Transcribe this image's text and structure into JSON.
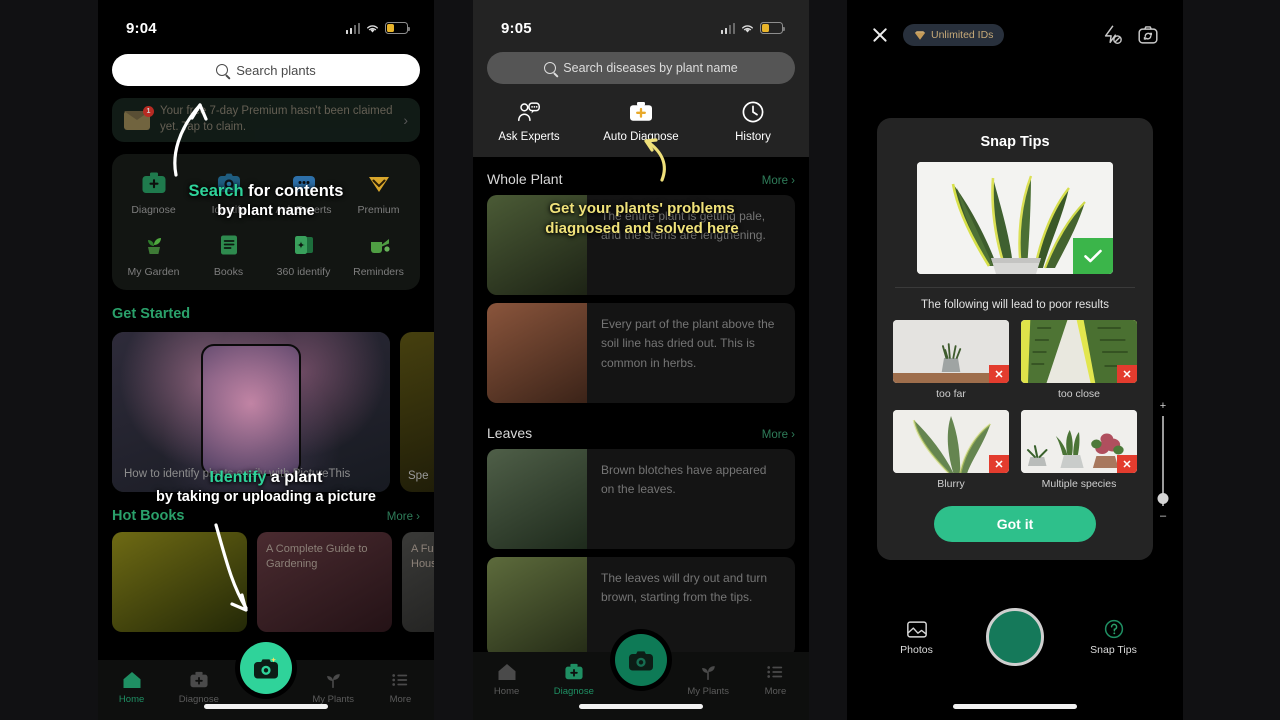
{
  "phone1": {
    "status": {
      "time": "9:04",
      "signal_icon": "cellular-signal-icon",
      "wifi_icon": "wifi-icon",
      "battery_icon": "battery-low-icon"
    },
    "search": {
      "placeholder": "Search plants",
      "icon": "search-icon"
    },
    "promo": {
      "text": "Your free 7-day Premium hasn't been claimed yet. Tap to claim.",
      "badge": "1",
      "icon": "envelope-icon",
      "chevron": "chevron-right-icon"
    },
    "shortcuts": [
      {
        "label": "Diagnose",
        "icon": "first-aid-kit-icon"
      },
      {
        "label": "Identify",
        "icon": "camera-identify-icon"
      },
      {
        "label": "Ask Experts",
        "icon": "chat-bubble-icon"
      },
      {
        "label": "Premium",
        "icon": "diamond-icon"
      },
      {
        "label": "My Garden",
        "icon": "potted-sprout-icon"
      },
      {
        "label": "Books",
        "icon": "book-icon"
      },
      {
        "label": "360 identify",
        "icon": "cards-icon"
      },
      {
        "label": "Reminders",
        "icon": "watering-can-icon"
      }
    ],
    "get_started": {
      "title": "Get Started",
      "card1_caption": "How to identify plants easily with PictureThis",
      "card2_caption": "Spe"
    },
    "hot_books": {
      "title": "Hot Books",
      "more": "More",
      "books": [
        "",
        "A Complete Guide to Gardening",
        "A Full Guide to Popular Houseplants"
      ]
    },
    "tabbar": [
      {
        "label": "Home",
        "icon": "home-icon",
        "active": true
      },
      {
        "label": "Diagnose",
        "icon": "first-aid-kit-icon",
        "active": false
      },
      {
        "label": "My Plants",
        "icon": "leaf-icon",
        "active": false
      },
      {
        "label": "More",
        "icon": "list-icon",
        "active": false
      }
    ],
    "fab": {
      "icon": "camera-icon"
    }
  },
  "phone2": {
    "status": {
      "time": "9:05"
    },
    "search": {
      "placeholder": "Search diseases by plant name",
      "icon": "search-icon"
    },
    "tabs": [
      {
        "label": "Ask Experts",
        "icon": "experts-chat-icon"
      },
      {
        "label": "Auto Diagnose",
        "icon": "first-aid-kit-icon"
      },
      {
        "label": "History",
        "icon": "clock-icon"
      }
    ],
    "sections": [
      {
        "title": "Whole Plant",
        "more": "More",
        "items": [
          {
            "text": "The entire plant is getting pale, and the stems are lengthening."
          },
          {
            "text": "Every part of the plant above the soil line has dried out. This is common in herbs."
          }
        ]
      },
      {
        "title": "Leaves",
        "more": "More",
        "items": [
          {
            "text": "Brown blotches have appeared on the leaves."
          },
          {
            "text": "The leaves will dry out and turn brown, starting from the tips."
          }
        ]
      }
    ],
    "tabbar": [
      {
        "label": "Home",
        "icon": "home-icon",
        "active": false
      },
      {
        "label": "Diagnose",
        "icon": "first-aid-kit-icon",
        "active": true
      },
      {
        "label": "My Plants",
        "icon": "leaf-icon",
        "active": false
      },
      {
        "label": "More",
        "icon": "list-icon",
        "active": false
      }
    ]
  },
  "phone3": {
    "close_icon": "close-icon",
    "premium_pill": {
      "label": "Unlimited IDs",
      "icon": "diamond-icon"
    },
    "flash_icon": "flash-off-icon",
    "flip_icon": "camera-flip-icon",
    "sheet": {
      "title": "Snap Tips",
      "good_example": {
        "caption_icon": "check-icon",
        "image": "snake-plant-photo"
      },
      "bad_title": "The following will lead to poor results",
      "bad_examples": [
        {
          "label": "too far",
          "image": "plant-too-far-photo"
        },
        {
          "label": "too close",
          "image": "leaf-too-close-photo"
        },
        {
          "label": "Blurry",
          "image": "blurry-plant-photo"
        },
        {
          "label": "Multiple species",
          "image": "multiple-plants-photo"
        }
      ],
      "cta": "Got it"
    },
    "zoom_slider": {
      "plus": "+",
      "minus": "–"
    },
    "camera_controls": [
      {
        "label": "Photos",
        "icon": "photos-icon"
      },
      {
        "label": "Snap Tips",
        "icon": "question-mark-icon"
      }
    ],
    "shutter": "shutter-button"
  },
  "annotations": {
    "a1_line1_green": "Search",
    "a1_line1_white": " for contents",
    "a1_line2": "by plant name",
    "a2_line1_green": "Identify",
    "a2_line1_white": " a plant",
    "a2_line2": "by taking or uploading a picture",
    "a3_line1": "Get your plants' problems",
    "a3_line2": "diagnosed and solved here"
  },
  "colors": {
    "accent_green": "#2fd39a",
    "section_green": "#2aa06a",
    "annotation_yellow": "#f0e27a",
    "danger_red": "#e33c2e",
    "premium_gold": "#c6a978"
  }
}
